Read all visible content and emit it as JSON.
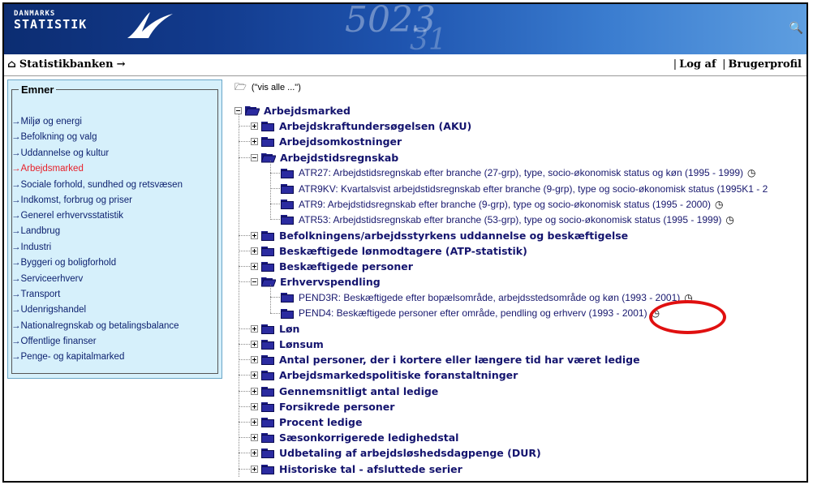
{
  "banner": {
    "brand_line1": "DANMARKS",
    "brand_line2": "STATISTIK",
    "deco_numbers": "5023",
    "deco_numbers2": "31",
    "search_icon": "search-icon"
  },
  "navbar": {
    "home_label": "Statistikbanken",
    "arrow": "→",
    "logout": "Log af",
    "sep": "|",
    "profile": "Brugerprofil"
  },
  "sidebar": {
    "legend": "Emner",
    "items": [
      {
        "label": "→Miljø og energi",
        "active": false
      },
      {
        "label": "→Befolkning og valg",
        "active": false
      },
      {
        "label": "→Uddannelse og kultur",
        "active": false
      },
      {
        "label": "→Arbejdsmarked",
        "active": true
      },
      {
        "label": "→Sociale forhold, sundhed og retsvæsen",
        "active": false
      },
      {
        "label": "→Indkomst, forbrug og priser",
        "active": false
      },
      {
        "label": "→Generel erhvervsstatistik",
        "active": false
      },
      {
        "label": "→Landbrug",
        "active": false
      },
      {
        "label": "→Industri",
        "active": false
      },
      {
        "label": "→Byggeri og boligforhold",
        "active": false
      },
      {
        "label": "→Serviceerhverv",
        "active": false
      },
      {
        "label": "→Transport",
        "active": false
      },
      {
        "label": "→Udenrigshandel",
        "active": false
      },
      {
        "label": "→Nationalregnskab og betalingsbalance",
        "active": false
      },
      {
        "label": "→Offentlige finanser",
        "active": false
      },
      {
        "label": "→Penge- og kapitalmarked",
        "active": false
      }
    ]
  },
  "tree": {
    "vis_alle": "(\"vis alle ...\")",
    "root": "Arbejdsmarked",
    "nodes": [
      {
        "label": "Arbejdskraftundersøgelsen (AKU)",
        "open": false
      },
      {
        "label": "Arbejdsomkostninger",
        "open": false
      },
      {
        "label": "Arbejdstidsregnskab",
        "open": true,
        "children": [
          "ATR27: Arbejdstidsregnskab efter branche (27-grp), type, socio-økonomisk status og køn (1995 - 1999)",
          "ATR9KV: Kvartalsvist arbejdstidsregnskab efter branche (9-grp), type og socio-økonomisk status (1995K1 - 2",
          "ATR9: Arbejdstidsregnskab efter branche (9-grp), type og socio-økonomisk status (1995 - 2000)",
          "ATR53: Arbejdstidsregnskab efter branche (53-grp), type og socio-økonomisk status (1995 - 1999)"
        ],
        "clock": [
          true,
          false,
          true,
          true
        ]
      },
      {
        "label": "Befolkningens/arbejdsstyrkens uddannelse og beskæftigelse",
        "open": false
      },
      {
        "label": "Beskæftigede lønmodtagere (ATP-statistik)",
        "open": false
      },
      {
        "label": "Beskæftigede personer",
        "open": false
      },
      {
        "label": "Erhvervspendling",
        "open": true,
        "children": [
          "PEND3R: Beskæftigede efter bopælsområde, arbejdsstedsområde og køn (1993 - 2001)",
          "PEND4: Beskæftigede personer efter område, pendling og erhverv (1993 - 2001)"
        ],
        "clock": [
          true,
          true
        ]
      },
      {
        "label": "Løn",
        "open": false
      },
      {
        "label": "Lønsum",
        "open": false
      },
      {
        "label": "Antal personer, der i kortere eller længere tid har været ledige",
        "open": false
      },
      {
        "label": "Arbejdsmarkedspolitiske foranstaltninger",
        "open": false
      },
      {
        "label": "Gennemsnitligt antal ledige",
        "open": false
      },
      {
        "label": "Forsikrede personer",
        "open": false
      },
      {
        "label": "Procent ledige",
        "open": false
      },
      {
        "label": "Sæsonkorrigerede ledighedstal",
        "open": false
      },
      {
        "label": "Udbetaling af arbejdsløshedsdagpenge (DUR)",
        "open": false
      },
      {
        "label": "Historiske tal - afsluttede serier",
        "open": false
      }
    ],
    "clock_glyph": "◷"
  },
  "colors": {
    "highlight_ellipse": "#e01010",
    "sidebar_bg": "#d6f0fb",
    "link": "#0b1f6e",
    "active": "#e8202a"
  }
}
